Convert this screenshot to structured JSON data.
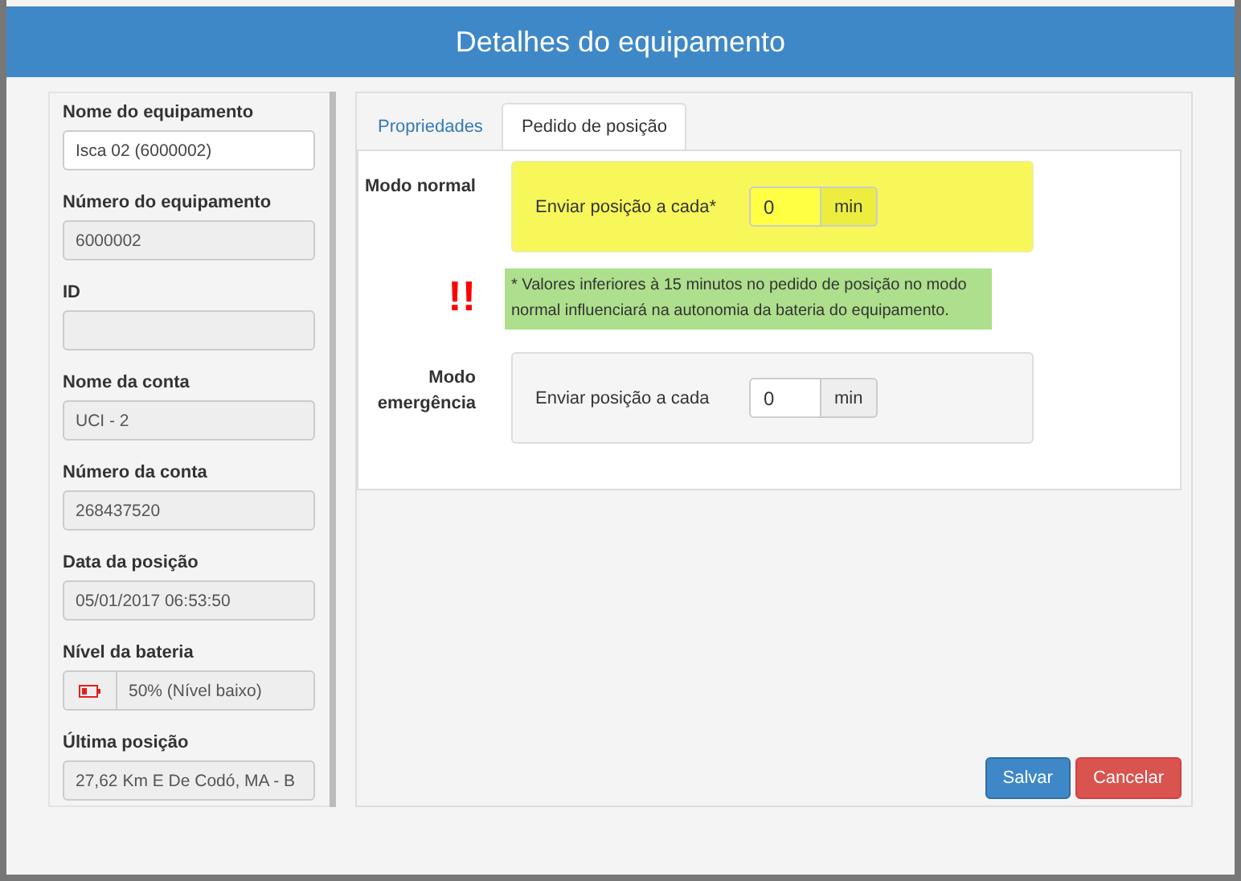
{
  "window": {
    "title": "Detalhes do equipamento"
  },
  "fields": [
    {
      "label": "Nome do equipamento",
      "kind": "text",
      "value": "Isca 02 (6000002)",
      "disabled": false
    },
    {
      "label": "Número do equipamento",
      "kind": "text",
      "value": "6000002",
      "disabled": true
    },
    {
      "label": "ID",
      "kind": "text",
      "disabled": true
    },
    {
      "label": "Nome da conta",
      "kind": "text",
      "value": "UCI - 2",
      "disabled": true
    },
    {
      "label": "Número da conta",
      "kind": "text",
      "value": "268437520",
      "disabled": true
    },
    {
      "label": "Data da posição",
      "kind": "text",
      "value": "05/01/2017 06:53:50",
      "disabled": true
    },
    {
      "label": "Nível da bateria",
      "kind": "battery",
      "value": "50% (Nível baixo)",
      "disabled": true
    },
    {
      "label": "Última posição",
      "kind": "text",
      "value": "27,62 Km E De Codó, MA - B",
      "disabled": true
    }
  ],
  "tabs": [
    {
      "label": "Propriedades",
      "selected": false
    },
    {
      "label": "Pedido de posição",
      "selected": true
    }
  ],
  "sections": [
    {
      "kind": "mode",
      "label": "Modo normal",
      "field_label": "Enviar posição a cada*",
      "value": "0",
      "unit": "min",
      "highlighted": true
    },
    {
      "kind": "note",
      "marker": "!!",
      "text": "* Valores inferiores à 15 minutos no pedido de posição no modo normal influenciará na autonomia da bateria do equipamento.",
      "highlighted": true
    },
    {
      "kind": "mode",
      "label": "Modo emergência",
      "field_label": "Enviar posição a cada",
      "value": "0",
      "unit": "min",
      "highlighted": false
    }
  ],
  "buttons": [
    {
      "label": "Salvar",
      "kind": "primary"
    },
    {
      "label": "Cancelar",
      "kind": "danger"
    }
  ]
}
